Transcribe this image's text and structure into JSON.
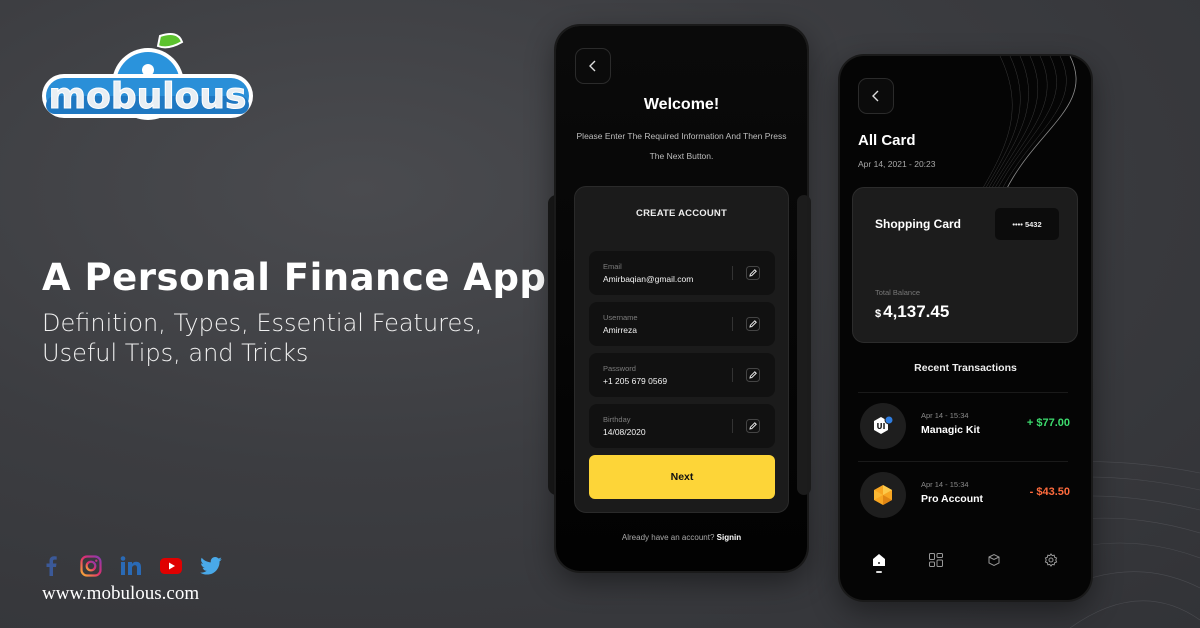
{
  "brand": {
    "logo_text": "mobulous",
    "website": "www.mobulous.com"
  },
  "hero": {
    "headline": "A Personal Finance App",
    "subheadline": "Definition, Types, Essential Features, Useful Tips, and Tricks"
  },
  "social": [
    {
      "icon": "facebook-icon",
      "color": "#3b5998"
    },
    {
      "icon": "instagram-icon",
      "color": "#d6436e"
    },
    {
      "icon": "linkedin-icon",
      "color": "#2a6ab5"
    },
    {
      "icon": "youtube-icon",
      "color": "#e00000"
    },
    {
      "icon": "twitter-icon",
      "color": "#49a9e9"
    }
  ],
  "signup_screen": {
    "back_icon": "chevron-left-icon",
    "title": "Welcome!",
    "description": "Please Enter The Required Information And Then Press The Next Button.",
    "card_title": "CREATE ACCOUNT",
    "fields": [
      {
        "label": "Email",
        "value": "Amirbaqian@gmail.com",
        "icon": "edit-icon"
      },
      {
        "label": "Username",
        "value": "Amirreza",
        "icon": "edit-icon"
      },
      {
        "label": "Password",
        "value": "+1 205 679 0569",
        "icon": "edit-icon"
      },
      {
        "label": "Birthday",
        "value": "14/08/2020",
        "icon": "edit-icon"
      }
    ],
    "next_label": "Next",
    "signin_prompt": "Already have an account?",
    "signin_link": "Signin",
    "accent": "#fdd538"
  },
  "cards_screen": {
    "back_icon": "chevron-left-icon",
    "title": "All Card",
    "date": "Apr 14, 2021 - 20:23",
    "card": {
      "name": "Shopping Card",
      "number_masked": "•••• 5432",
      "balance_label": "Total Balance",
      "currency": "$",
      "balance": "4,137.45"
    },
    "recent_title": "Recent Transactions",
    "transactions": [
      {
        "time": "Apr 14 - 15:34",
        "name": "Managic Kit",
        "amount": "+ $77.00",
        "icon": "ui-kit-icon",
        "color": "#3ddc6e"
      },
      {
        "time": "Apr 14 - 15:34",
        "name": "Pro Account",
        "amount": "- $43.50",
        "icon": "sketch-gem-icon",
        "color": "#ff6b3d"
      }
    ],
    "nav": [
      {
        "icon": "home-icon",
        "active": true
      },
      {
        "icon": "grid-icon",
        "active": false
      },
      {
        "icon": "box-icon",
        "active": false
      },
      {
        "icon": "settings-icon",
        "active": false
      }
    ]
  }
}
